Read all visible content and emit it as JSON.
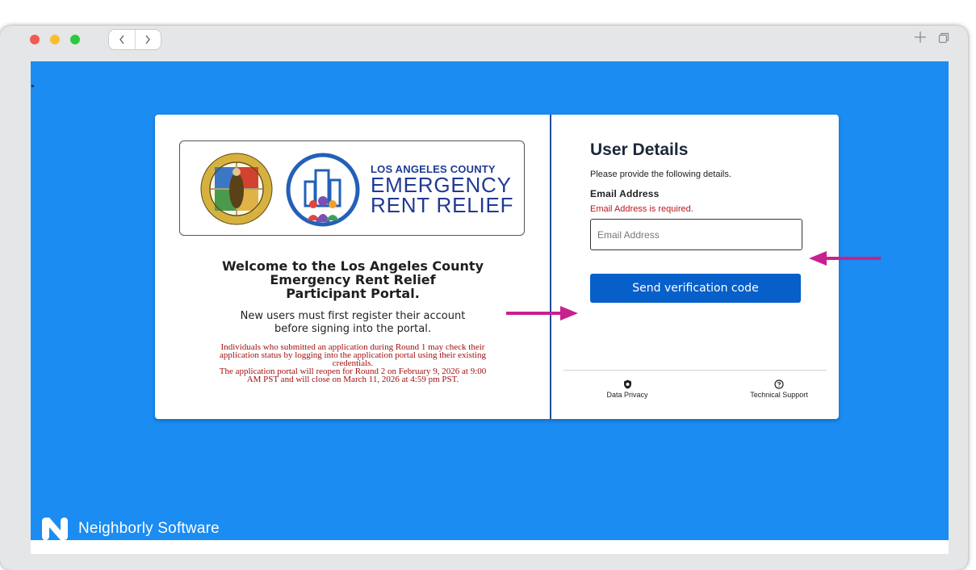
{
  "browser": {
    "back_icon": "chevron-left-icon",
    "forward_icon": "chevron-right-icon",
    "new_tab_icon": "plus-icon",
    "tab_overview_icon": "tabs-icon"
  },
  "logo": {
    "line1": "LOS ANGELES COUNTY",
    "line2": "EMERGENCY",
    "line3": "RENT RELIEF",
    "seal_text_top": "COUNTY OF LOS ANGELES",
    "seal_text_bottom": "CALIFORNIA"
  },
  "welcome": {
    "title_line1": "Welcome to the Los Angeles County",
    "title_line2": "Emergency Rent Relief",
    "title_line3": "Participant Portal.",
    "sub_line1": "New users must first register their account",
    "sub_line2": "before signing into the portal.",
    "notice_line1": "Individuals who submitted an application during Round 1 may check their",
    "notice_line2": "application status by logging into the application portal using their existing",
    "notice_line3": "credentials.",
    "notice_line4": "The application portal will reopen for Round 2 on February 9, 2026 at 9:00",
    "notice_line5": "AM PST and will close on March 11, 2026 at 4:59 pm PST."
  },
  "user_details": {
    "title": "User Details",
    "description": "Please provide the following details.",
    "email_label": "Email Address",
    "email_error": "Email Address is required.",
    "email_placeholder": "Email Address",
    "email_value": "",
    "send_button": "Send verification code"
  },
  "footer": {
    "data_privacy": "Data Privacy",
    "technical_support": "Technical Support"
  },
  "brand": {
    "name": "Neighborly Software"
  },
  "colors": {
    "page_bg": "#1b8cf1",
    "primary_button": "#0760c9",
    "error_text": "#c0151b",
    "notice_text": "#a11010",
    "annotation_arrow": "#c8218e",
    "card_divider": "#214b99"
  }
}
